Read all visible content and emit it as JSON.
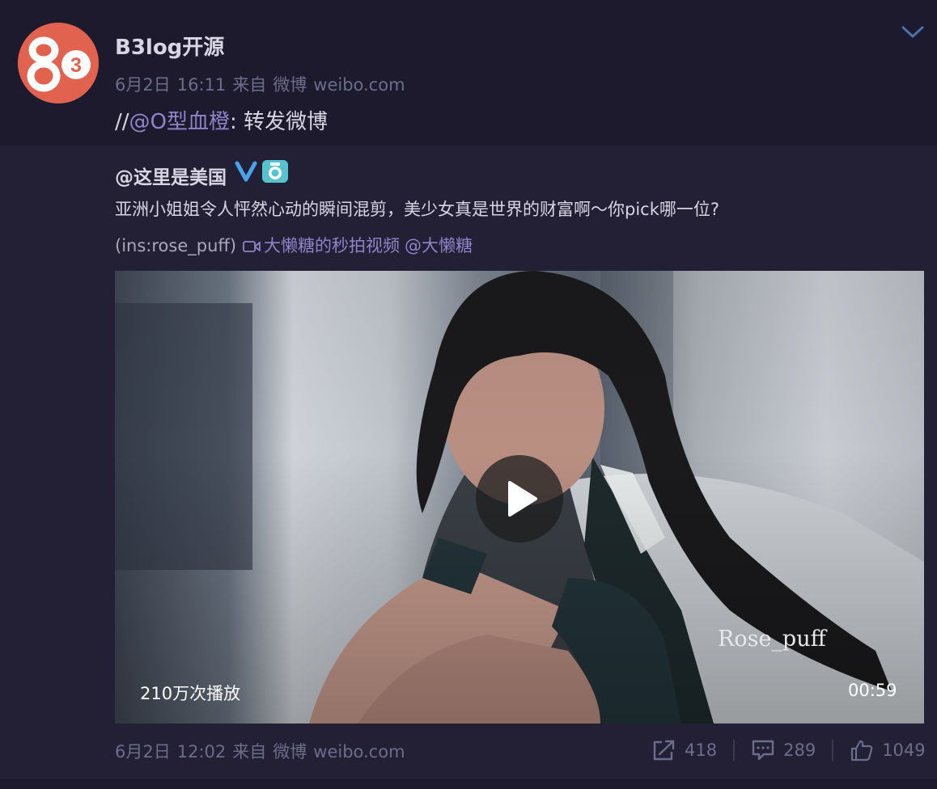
{
  "post": {
    "author": "B3log开源",
    "meta": {
      "date": "6月2日",
      "time": "16:11",
      "from": "来自",
      "source_name": "微博",
      "source_domain": "weibo.com"
    },
    "repost": {
      "prefix": "//",
      "mention": "@O型血橙",
      "suffix": ": 转发微博"
    }
  },
  "quoted": {
    "author": "@这里是美国",
    "text": "亚洲小姐姐令人怦然心动的瞬间混剪，美少女真是世界的财富啊～你pick哪一位?",
    "credit": "(ins:rose_puff)",
    "video_link": "大懒糖的秒拍视频",
    "mention": "@大懒糖",
    "video": {
      "watermark": "Rose_puff",
      "views": "210万次播放",
      "duration": "00:59"
    },
    "meta": {
      "date": "6月2日",
      "time": "12:02",
      "from": "来自",
      "source_name": "微博",
      "source_domain": "weibo.com"
    },
    "actions": {
      "reposts": "418",
      "comments": "289",
      "likes": "1049"
    }
  },
  "icons": [
    "chevron-down-icon",
    "verified-v-icon",
    "camera-badge-icon",
    "video-icon",
    "play-icon",
    "repost-icon",
    "comment-icon",
    "like-icon"
  ],
  "colors": {
    "background": "#1e1a2e",
    "quote_background": "#231f35",
    "text": "#d8d6e2",
    "muted": "#6a6d8c",
    "link": "#8f84c8",
    "avatar_red": "#e0624f",
    "verified_blue": "#4aa3e8",
    "camera_teal": "#56c4cf"
  }
}
